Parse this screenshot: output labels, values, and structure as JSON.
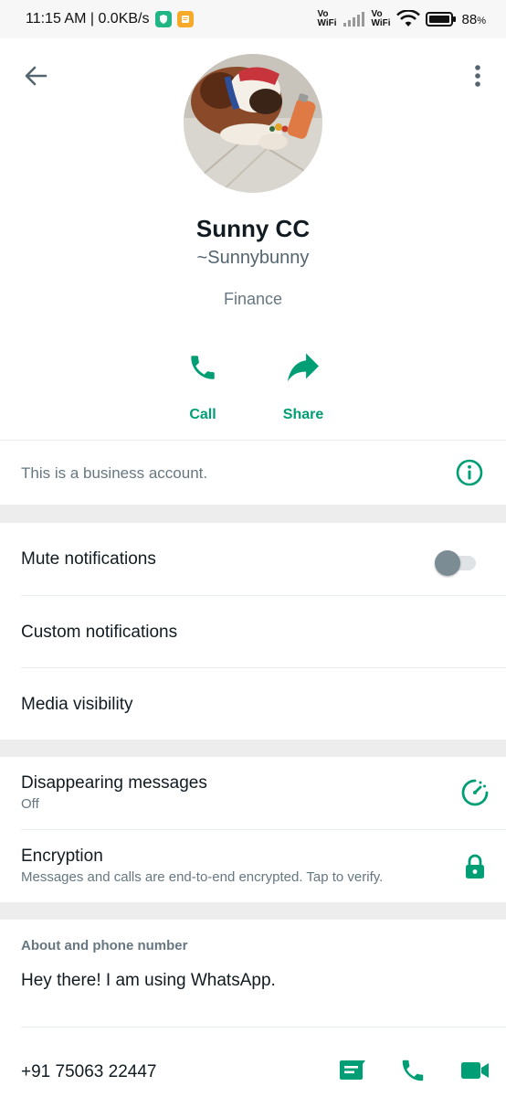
{
  "status_bar": {
    "time_speed": "11:15 AM | 0.0KB/s",
    "vowifi_1": "Vo\nWiFi",
    "vowifi_2": "Vo\nWiFi",
    "battery": "88",
    "battery_unit": "%"
  },
  "profile": {
    "name": "Sunny CC",
    "push_name": "~Sunnybunny",
    "category": "Finance",
    "actions": [
      {
        "label": "Call"
      },
      {
        "label": "Share"
      }
    ]
  },
  "business_notice": {
    "text": "This is a business account."
  },
  "notifications": {
    "mute_label": "Mute notifications",
    "mute_enabled": false,
    "custom_label": "Custom notifications",
    "media_label": "Media visibility"
  },
  "privacy": {
    "disappearing_title": "Disappearing messages",
    "disappearing_value": "Off",
    "encryption_title": "Encryption",
    "encryption_sub": "Messages and calls are end-to-end encrypted. Tap to verify."
  },
  "about": {
    "header": "About and phone number",
    "text": "Hey there! I am using WhatsApp.",
    "phone": "+91 75063 22447"
  },
  "colors": {
    "accent": "#009e74",
    "text_primary": "#111b21",
    "text_secondary": "#667781",
    "background_gap": "#ededed"
  },
  "icons": [
    "back-arrow-icon",
    "more-vertical-icon",
    "phone-icon",
    "share-icon",
    "info-icon",
    "timer-icon",
    "lock-icon",
    "message-icon",
    "video-icon"
  ]
}
